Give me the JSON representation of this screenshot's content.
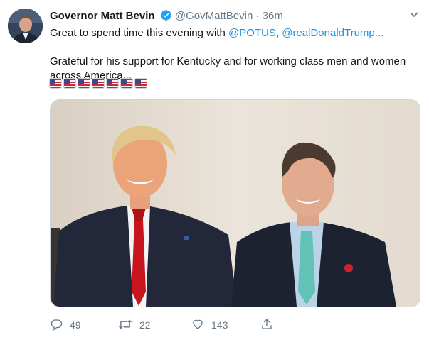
{
  "author": {
    "name": "Governor Matt Bevin",
    "handle": "@GovMattBevin",
    "separator": "·",
    "time": "36m"
  },
  "tweet": {
    "line1_prefix": "Great to spend time this evening with ",
    "mention1": "@POTUS",
    "comma": ", ",
    "mention2": "@realDonaldTrump...",
    "line2": "Grateful for his support for Kentucky and for working class men and women across America...",
    "flags_count": 7
  },
  "actions": {
    "replies": "49",
    "retweets": "22",
    "likes": "143"
  },
  "icons": [
    "verified-badge-icon",
    "chevron-down-icon",
    "reply-icon",
    "retweet-icon",
    "like-icon",
    "share-icon"
  ],
  "colors": {
    "link": "#1b95e0",
    "verified": "#1da1f2",
    "muted": "#657786"
  }
}
